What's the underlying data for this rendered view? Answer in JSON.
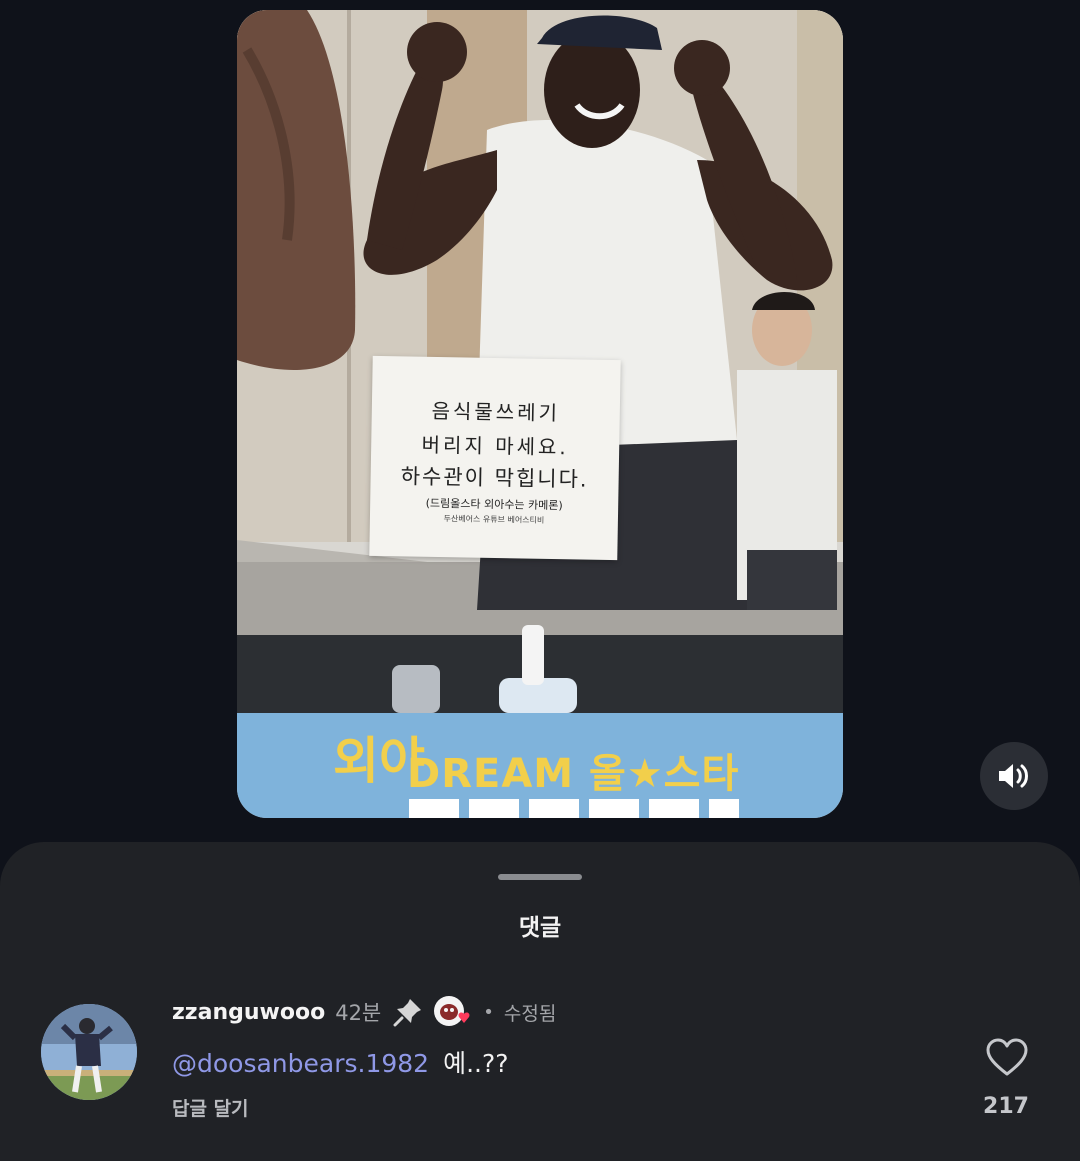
{
  "video": {
    "sign_lines": [
      "음식물쓰레기",
      "버리지 마세요.",
      "하수관이 막힙니다.",
      "(드림올스타 외아수는 카메론)",
      "두산베어스 유튜브 베어스티비"
    ],
    "banner_left": "외야",
    "banner_headline": "DREAM 올★스타"
  },
  "sound_button": {
    "icon": "speaker-icon"
  },
  "comments": {
    "title": "댓글",
    "items": [
      {
        "username": "zzanguwooo",
        "time": "42분",
        "pinned": true,
        "author_liked": true,
        "separator": "•",
        "edited_label": "수정됨",
        "mention": "@doosanbears.1982",
        "text": "예..??",
        "reply_label": "답글 달기",
        "like_count": "217"
      }
    ]
  },
  "colors": {
    "background": "#0f121a",
    "sheet": "#202226",
    "mention": "#8f98e6",
    "banner": "#7fb3db",
    "banner_text": "#f2cf4b"
  }
}
